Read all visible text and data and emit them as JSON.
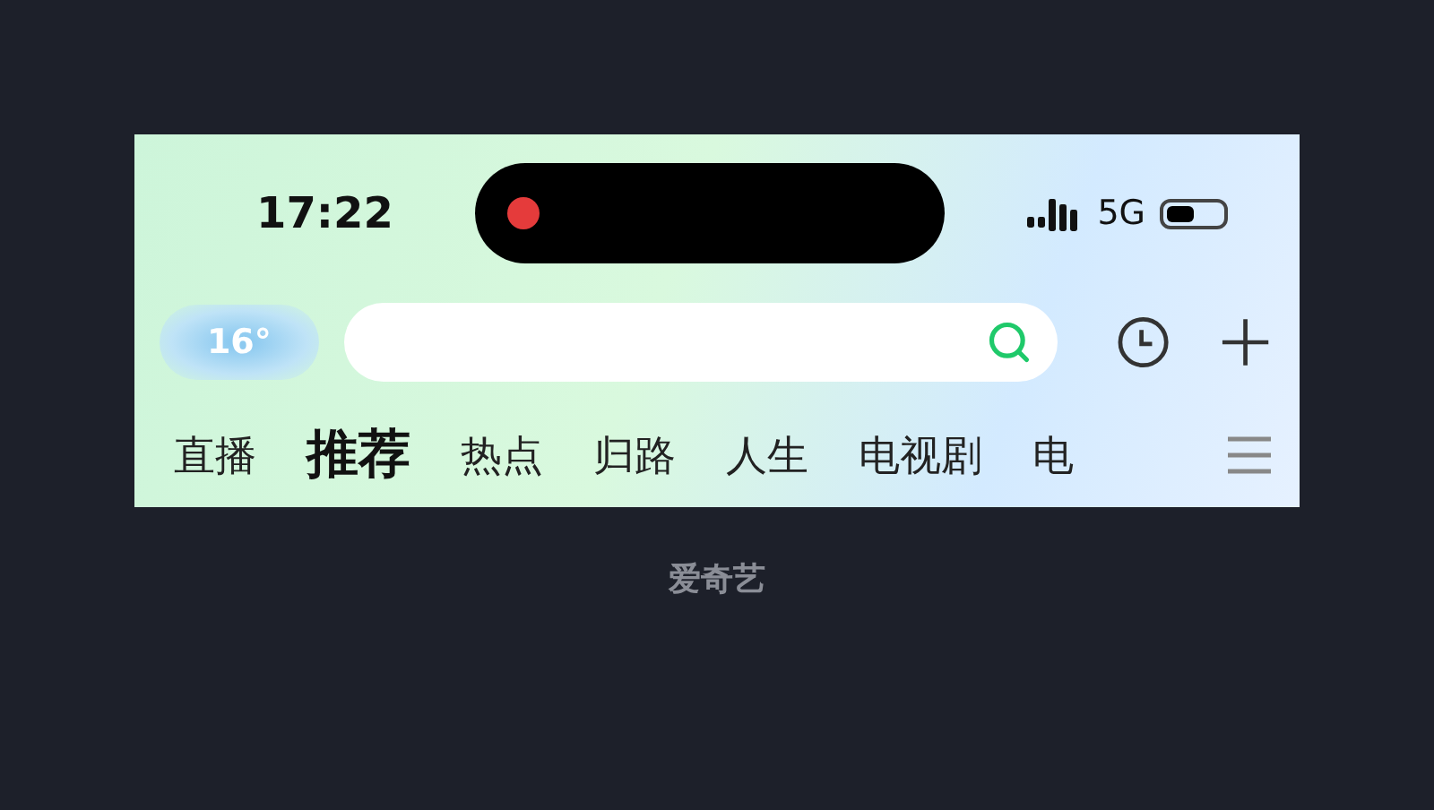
{
  "status_bar": {
    "time": "17:22",
    "recording": true,
    "network": "5G"
  },
  "header": {
    "weather": "16°"
  },
  "tabs": [
    {
      "label": "直播",
      "selected": false
    },
    {
      "label": "推荐",
      "selected": true
    },
    {
      "label": "热点",
      "selected": false
    },
    {
      "label": "归路",
      "selected": false
    },
    {
      "label": "人生",
      "selected": false
    },
    {
      "label": "电视剧",
      "selected": false
    },
    {
      "label": "电",
      "selected": false
    }
  ],
  "caption": "爱奇艺"
}
